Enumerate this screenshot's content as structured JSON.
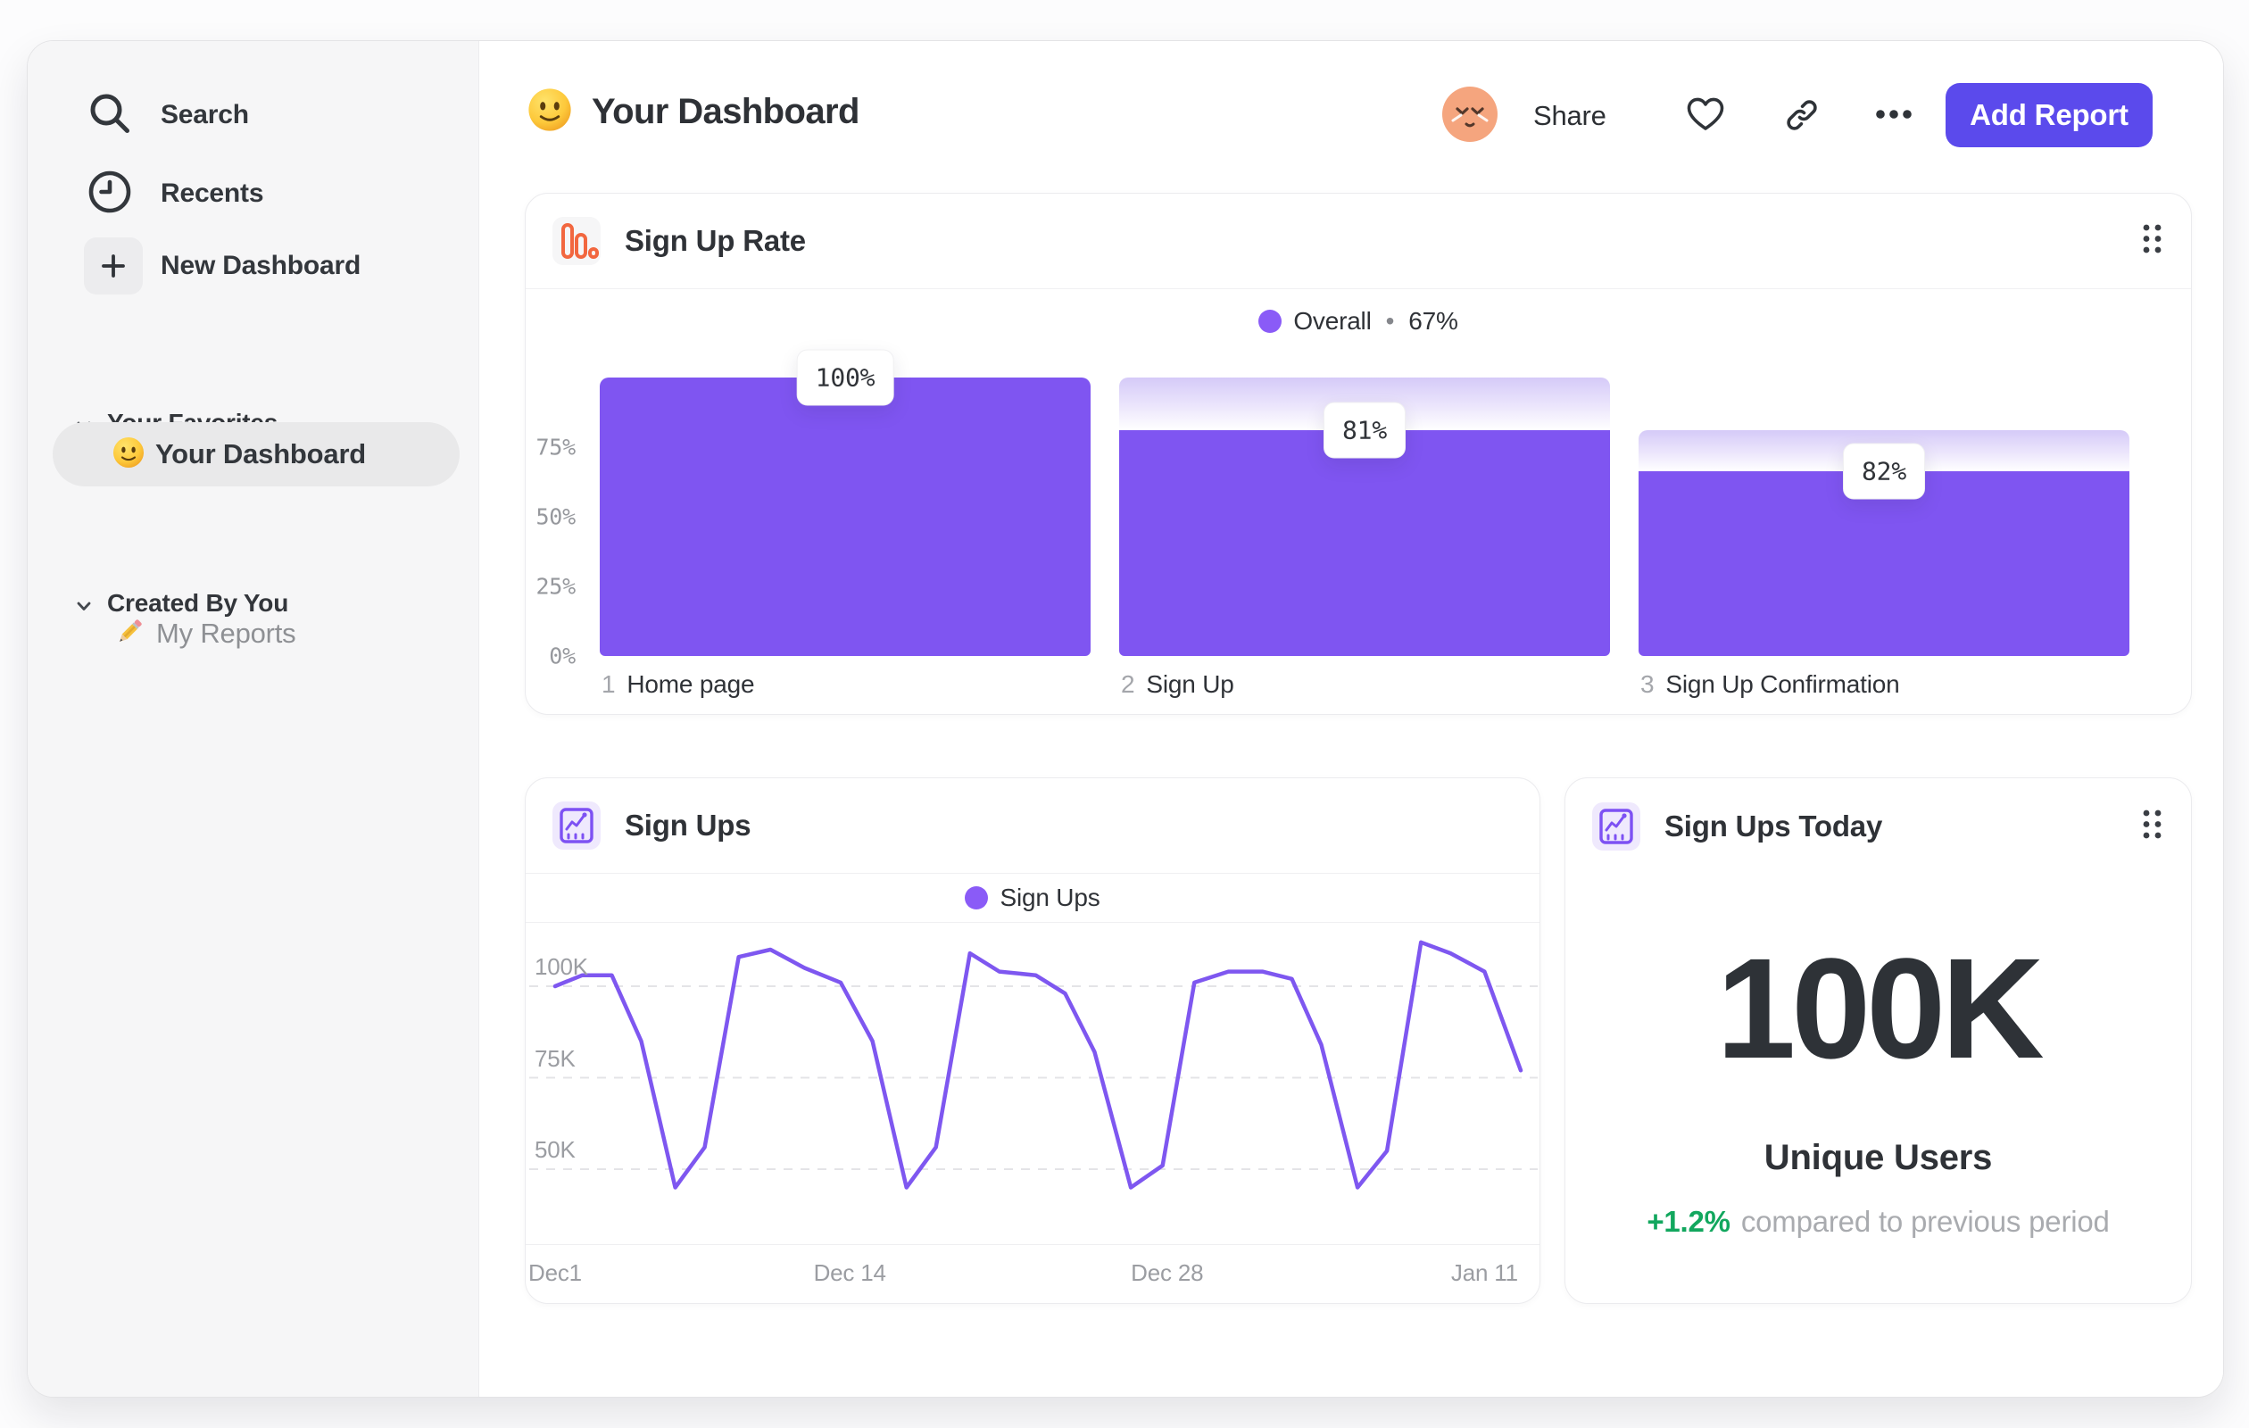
{
  "colors": {
    "accent_purple": "#7f55f1",
    "legend_dot_purple": "#8a5bf7",
    "line_purple": "#7e57f0",
    "button_indigo": "#5b4aec",
    "funnel_icon_orange": "#f2673f",
    "positive_green": "#12a75e"
  },
  "sidebar": {
    "nav": [
      {
        "icon": "search-icon",
        "label": "Search"
      },
      {
        "icon": "clock-icon",
        "label": "Recents"
      },
      {
        "icon": "plus-icon",
        "label": "New Dashboard"
      }
    ],
    "sections": [
      {
        "title": "Your Favorites",
        "items": [
          {
            "icon": "smiley-emoji-icon",
            "label": "Your Dashboard",
            "selected": true
          }
        ]
      },
      {
        "title": "Created By You",
        "items": [
          {
            "icon": "pencil-emoji-icon",
            "label": "My Reports",
            "selected": false
          }
        ]
      }
    ]
  },
  "header": {
    "title_emoji": "smiley-emoji-icon",
    "title": "Your Dashboard",
    "share_label": "Share",
    "add_report_label": "Add Report"
  },
  "funnel_card": {
    "title": "Sign Up Rate",
    "legend": {
      "label": "Overall",
      "separator": "•",
      "value": "67%"
    }
  },
  "line_card": {
    "title": "Sign Ups",
    "legend": {
      "label": "Sign Ups"
    }
  },
  "today_card": {
    "title": "Sign Ups Today",
    "value": "100K",
    "value_label": "Unique Users",
    "delta": "+1.2%",
    "delta_description": "compared to previous period"
  },
  "chart_data": [
    {
      "type": "bar",
      "subtype": "funnel",
      "title": "Sign Up Rate",
      "categories": [
        "Home page",
        "Sign Up",
        "Sign Up Confirmation"
      ],
      "step_numbers": [
        "1",
        "2",
        "3"
      ],
      "conversion_labels": [
        "100%",
        "81%",
        "82%"
      ],
      "values_pct_of_total": [
        100,
        81,
        66.4
      ],
      "prev_values_pct_of_total": [
        100,
        100,
        81
      ],
      "overall_conversion": "67%",
      "y_ticks": [
        "75%",
        "50%",
        "25%",
        "0%"
      ],
      "y_tick_values": [
        75,
        50,
        25,
        0
      ],
      "ylim": [
        0,
        100
      ],
      "legend": [
        {
          "name": "Overall",
          "value": "67%",
          "color": "#8a5bf7"
        }
      ],
      "legend_position": "top center",
      "grid": "off"
    },
    {
      "type": "line",
      "title": "Sign Ups",
      "series_name": "Sign Ups",
      "x_unit": "days since Dec 1",
      "x": [
        0,
        1.2,
        2.5,
        3.8,
        5.3,
        6.6,
        8.1,
        9.5,
        11.0,
        12.6,
        14.0,
        15.5,
        16.8,
        18.3,
        19.6,
        21.2,
        22.5,
        23.8,
        25.4,
        26.8,
        28.2,
        29.7,
        31.2,
        32.5,
        33.8,
        35.4,
        36.7,
        38.2,
        39.5,
        41.0,
        42.6
      ],
      "values_k": [
        100,
        103,
        103,
        85,
        45,
        56,
        108,
        110,
        105,
        101,
        85,
        45,
        56,
        109,
        104,
        103,
        98,
        82,
        45,
        51,
        101,
        104,
        104,
        102,
        84,
        45,
        55,
        112,
        109,
        104,
        77
      ],
      "x_ticks": [
        {
          "label": "Dec1",
          "day": 0
        },
        {
          "label": "Dec 14",
          "day": 13
        },
        {
          "label": "Dec 28",
          "day": 27
        },
        {
          "label": "Jan 11",
          "day": 41
        }
      ],
      "y_ticks": [
        {
          "label": "100K",
          "value": 100
        },
        {
          "label": "75K",
          "value": 75
        },
        {
          "label": "50K",
          "value": 50
        }
      ],
      "ylim_k": [
        38,
        115
      ],
      "xlim_days": [
        0,
        42.6
      ],
      "grid": "dashed horizontal",
      "legend_position": "top center",
      "color": "#7e57f0"
    },
    {
      "type": "number",
      "title": "Sign Ups Today",
      "value": "100K",
      "label": "Unique Users",
      "delta": "+1.2%",
      "delta_description": "compared to previous period"
    }
  ]
}
